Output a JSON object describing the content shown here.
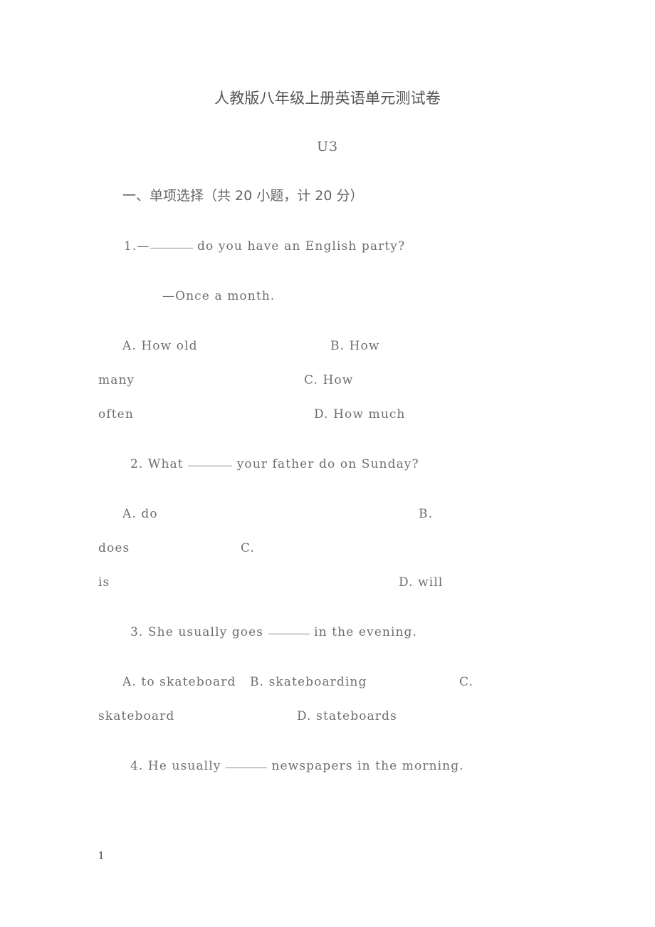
{
  "document": {
    "title": "人教版八年级上册英语单元测试卷",
    "subtitle": "U3",
    "page_number": "1",
    "background_color": "#ffffff",
    "text_color": "#6e6e6e"
  },
  "section": {
    "heading": "一、单项选择（共 20 小题，计 20 分）"
  },
  "questions": [
    {
      "number": "1.",
      "stem_prefix": "1.—",
      "stem_suffix": " do you have an English party?",
      "answer_line": "—Once a month.",
      "option_lines": [
        {
          "left": "A. How old",
          "right": "B. How"
        },
        {
          "left": "many",
          "right": "C. How"
        },
        {
          "left": "often",
          "right": "D. How much"
        }
      ]
    },
    {
      "number": "2.",
      "stem_prefix": "2. What ",
      "stem_suffix": " your father do on Sunday?",
      "option_lines": [
        {
          "left": "A. do",
          "right": "B."
        },
        {
          "left": "does",
          "right": "C."
        },
        {
          "left": "is",
          "right": "D. will"
        }
      ]
    },
    {
      "number": "3.",
      "stem_prefix": "3. She usually goes ",
      "stem_suffix": " in the evening.",
      "option_lines": [
        {
          "left": "A. to skateboard   B. skateboarding",
          "right": "C."
        },
        {
          "left": "skateboard",
          "right": "D. stateboards"
        }
      ]
    },
    {
      "number": "4.",
      "stem_prefix": "4. He usually ",
      "stem_suffix": " newspapers in the morning."
    }
  ]
}
